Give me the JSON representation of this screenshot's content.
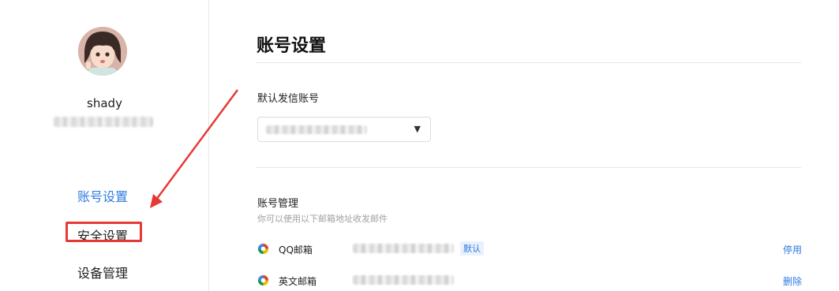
{
  "sidebar": {
    "username": "shady",
    "nav": [
      {
        "label": "账号设置",
        "active": true
      },
      {
        "label": "安全设置",
        "active": false
      },
      {
        "label": "设备管理",
        "active": false
      }
    ]
  },
  "main": {
    "title": "账号设置",
    "default_sender": {
      "label": "默认发信账号"
    },
    "accounts": {
      "label": "账号管理",
      "hint": "你可以使用以下邮箱地址收发邮件",
      "items": [
        {
          "name": "QQ邮箱",
          "badge": "默认",
          "action": "停用"
        },
        {
          "name": "英文邮箱",
          "badge": "",
          "action": "删除"
        }
      ]
    }
  },
  "colors": {
    "accent": "#2e7be0",
    "highlight": "#e53935"
  }
}
